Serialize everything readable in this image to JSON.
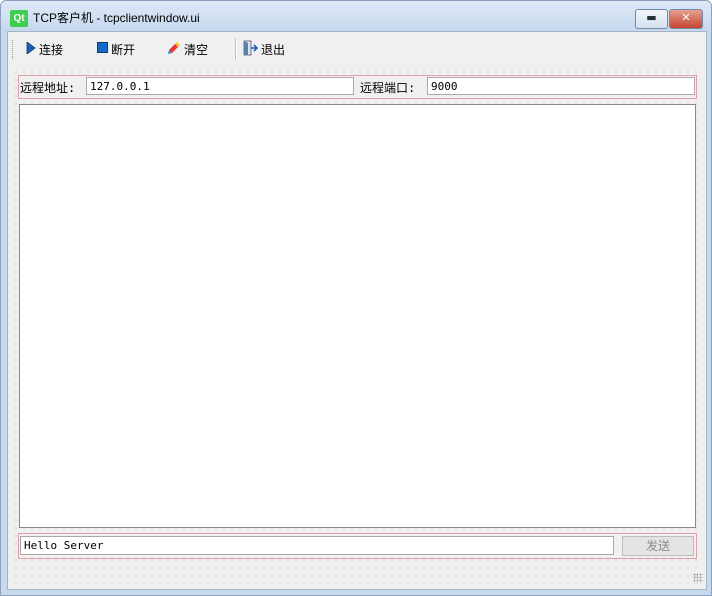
{
  "window": {
    "title": "TCP客户机 - tcpclientwindow.ui",
    "logo_text": "Qt",
    "minimize_glyph": "▬",
    "close_glyph": "✕"
  },
  "toolbar": {
    "connect": {
      "label": "连接",
      "icon": "play-icon"
    },
    "disconnect": {
      "label": "断开",
      "icon": "stop-icon"
    },
    "clear": {
      "label": "清空",
      "icon": "eraser-icon"
    },
    "exit": {
      "label": "退出",
      "icon": "exit-door-icon"
    }
  },
  "connection": {
    "address_label": "远程地址:",
    "address_value": "127.0.0.1",
    "port_label": "远程端口:",
    "port_value": "9000"
  },
  "output": {
    "content": ""
  },
  "send": {
    "input_value": "Hello Server",
    "button_label": "发送"
  },
  "colors": {
    "qt_green": "#41cd52",
    "highlight_border": "#e0a0a8",
    "close_red": "#c5432f"
  }
}
